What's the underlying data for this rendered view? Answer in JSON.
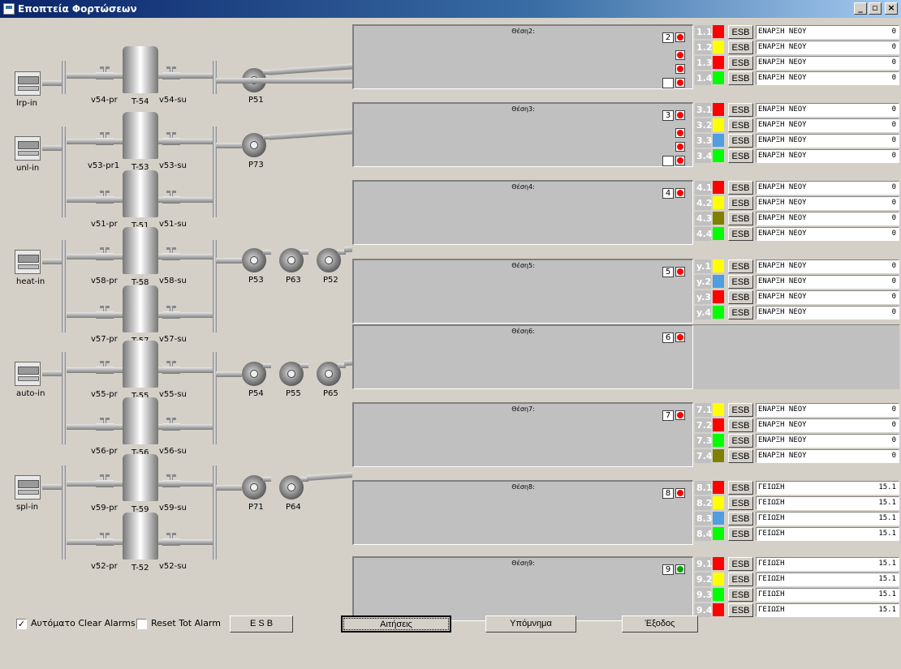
{
  "window": {
    "title": "Εποπτεία Φορτώσεων",
    "minimize": "_",
    "restore": "▫",
    "close": "×"
  },
  "inlets": [
    {
      "label": "lrp-in"
    },
    {
      "label": "unl-in"
    },
    {
      "label": "heat-in"
    },
    {
      "label": "auto-in"
    },
    {
      "label": "spl-in"
    }
  ],
  "tanks": [
    {
      "name": "T-54",
      "pr": "v54-pr",
      "su": "v54-su"
    },
    {
      "name": "T-53",
      "pr": "v53-pr1",
      "su": "v53-su"
    },
    {
      "name": "T-51",
      "pr": "v51-pr",
      "su": "v51-su"
    },
    {
      "name": "T-58",
      "pr": "v58-pr",
      "su": "v58-su"
    },
    {
      "name": "T-57",
      "pr": "v57-pr",
      "su": "v57-su"
    },
    {
      "name": "T-55",
      "pr": "v55-pr",
      "su": "v55-su"
    },
    {
      "name": "T-56",
      "pr": "v56-pr",
      "su": "v56-su"
    },
    {
      "name": "T-59",
      "pr": "v59-pr",
      "su": "v59-su"
    },
    {
      "name": "T-52",
      "pr": "v52-pr",
      "su": "v52-su"
    }
  ],
  "pumps": [
    "P51",
    "P73",
    "P53",
    "P63",
    "P52",
    "P54",
    "P55",
    "P65",
    "P71",
    "P64"
  ],
  "stations": [
    {
      "title": "Θέση2:",
      "num": "2",
      "led": "red",
      "rows": [
        {
          "id": "1.1",
          "color": "#ff0000",
          "esb": "ESB",
          "text": "ΕΝΑΡΞΗ ΝΕΟΥ",
          "value": "0"
        },
        {
          "id": "1.2",
          "color": "#ffff00",
          "esb": "ESB",
          "text": "ΕΝΑΡΞΗ ΝΕΟΥ",
          "value": "0"
        },
        {
          "id": "1.3",
          "color": "#ff0000",
          "esb": "ESB",
          "text": "ΕΝΑΡΞΗ ΝΕΟΥ",
          "value": "0"
        },
        {
          "id": "1.4",
          "color": "#00ff00",
          "esb": "ESB",
          "text": "ΕΝΑΡΞΗ ΝΕΟΥ",
          "value": "0"
        }
      ]
    },
    {
      "title": "Θέση3:",
      "num": "3",
      "led": "red",
      "rows": [
        {
          "id": "3.1",
          "color": "#ff0000",
          "esb": "ESB",
          "text": "ΕΝΑΡΞΗ ΝΕΟΥ",
          "value": "0"
        },
        {
          "id": "3.2",
          "color": "#ffff00",
          "esb": "ESB",
          "text": "ΕΝΑΡΞΗ ΝΕΟΥ",
          "value": "0"
        },
        {
          "id": "3.3",
          "color": "#4f9ee0",
          "esb": "ESB",
          "text": "ΕΝΑΡΞΗ ΝΕΟΥ",
          "value": "0"
        },
        {
          "id": "3.4",
          "color": "#00ff00",
          "esb": "ESB",
          "text": "ΕΝΑΡΞΗ ΝΕΟΥ",
          "value": "0"
        }
      ]
    },
    {
      "title": "Θέση4:",
      "num": "4",
      "led": "red",
      "rows": [
        {
          "id": "4.1",
          "color": "#ff0000",
          "esb": "ESB",
          "text": "ΕΝΑΡΞΗ ΝΕΟΥ",
          "value": "0"
        },
        {
          "id": "4.2",
          "color": "#ffff00",
          "esb": "ESB",
          "text": "ΕΝΑΡΞΗ ΝΕΟΥ",
          "value": "0"
        },
        {
          "id": "4.3",
          "color": "#7f7f00",
          "esb": "ESB",
          "text": "ΕΝΑΡΞΗ ΝΕΟΥ",
          "value": "0"
        },
        {
          "id": "4.4",
          "color": "#00ff00",
          "esb": "ESB",
          "text": "ΕΝΑΡΞΗ ΝΕΟΥ",
          "value": "0"
        }
      ]
    },
    {
      "title": "Θέση5:",
      "num": "5",
      "led": "red",
      "rows": [
        {
          "id": "y.1",
          "color": "#ffff00",
          "esb": "ESB",
          "text": "ΕΝΑΡΞΗ ΝΕΟΥ",
          "value": "0"
        },
        {
          "id": "y.2",
          "color": "#4f9ee0",
          "esb": "ESB",
          "text": "ΕΝΑΡΞΗ ΝΕΟΥ",
          "value": "0"
        },
        {
          "id": "y.3",
          "color": "#ff0000",
          "esb": "ESB",
          "text": "ΕΝΑΡΞΗ ΝΕΟΥ",
          "value": "0"
        },
        {
          "id": "y.4",
          "color": "#00ff00",
          "esb": "ESB",
          "text": "ΕΝΑΡΞΗ ΝΕΟΥ",
          "value": "0"
        }
      ]
    },
    {
      "title": "Θέση6:",
      "num": "6",
      "led": "red",
      "rows": []
    },
    {
      "title": "Θέση7:",
      "num": "7",
      "led": "red",
      "rows": [
        {
          "id": "7.1",
          "color": "#ffff00",
          "esb": "ESB",
          "text": "ΕΝΑΡΞΗ ΝΕΟΥ",
          "value": "0"
        },
        {
          "id": "7.2",
          "color": "#ff0000",
          "esb": "ESB",
          "text": "ΕΝΑΡΞΗ ΝΕΟΥ",
          "value": "0"
        },
        {
          "id": "7.3",
          "color": "#00ff00",
          "esb": "ESB",
          "text": "ΕΝΑΡΞΗ ΝΕΟΥ",
          "value": "0"
        },
        {
          "id": "7.4",
          "color": "#7f7f00",
          "esb": "ESB",
          "text": "ΕΝΑΡΞΗ ΝΕΟΥ",
          "value": "0"
        }
      ]
    },
    {
      "title": "Θέση8:",
      "num": "8",
      "led": "red",
      "rows": [
        {
          "id": "8.1",
          "color": "#ff0000",
          "esb": "ESB",
          "text": "ΓΕΙΩΣΗ",
          "value": "15.1"
        },
        {
          "id": "8.2",
          "color": "#ffff00",
          "esb": "ESB",
          "text": "ΓΕΙΩΣΗ",
          "value": "15.1"
        },
        {
          "id": "8.3",
          "color": "#4f9ee0",
          "esb": "ESB",
          "text": "ΓΕΙΩΣΗ",
          "value": "15.1"
        },
        {
          "id": "8.4",
          "color": "#00ff00",
          "esb": "ESB",
          "text": "ΓΕΙΩΣΗ",
          "value": "15.1"
        }
      ]
    },
    {
      "title": "Θέση9:",
      "num": "9",
      "led": "green",
      "rows": [
        {
          "id": "9.1",
          "color": "#ff0000",
          "esb": "ESB",
          "text": "ΓΕΙΩΣΗ",
          "value": "15.1"
        },
        {
          "id": "9.2",
          "color": "#ffff00",
          "esb": "ESB",
          "text": "ΓΕΙΩΣΗ",
          "value": "15.1"
        },
        {
          "id": "9.3",
          "color": "#00ff00",
          "esb": "ESB",
          "text": "ΓΕΙΩΣΗ",
          "value": "15.1"
        },
        {
          "id": "9.4",
          "color": "#ff0000",
          "esb": "ESB",
          "text": "ΓΕΙΩΣΗ",
          "value": "15.1"
        }
      ]
    }
  ],
  "footer": {
    "auto_clear_label": "Αυτόματο Clear Alarms",
    "auto_clear_checked": true,
    "reset_tot_label": "Reset Tot Alarm",
    "reset_tot_checked": false,
    "esb_button": "E S B",
    "requests_button": "Αιτήσεις",
    "legend_button": "Υπόμνημα",
    "exit_button": "Έξοδος"
  }
}
